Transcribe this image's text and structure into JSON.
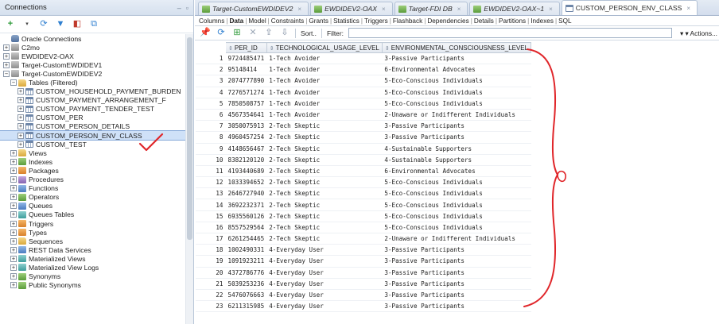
{
  "left_panel": {
    "title": "Connections",
    "root": "Oracle Connections",
    "connections": [
      "C2mo",
      "EWDIDEV2-OAX",
      "Target-CustomEWDIDEV1",
      "Target-CustomEWDIDEV2"
    ],
    "tables_folder": "Tables (Filtered)",
    "tables": [
      "CUSTOM_HOUSEHOLD_PAYMENT_BURDEN",
      "CUSTOM_PAYMENT_ARRANGEMENT_F",
      "CUSTOM_PAYMENT_TENDER_TEST",
      "CUSTOM_PER",
      "CUSTOM_PERSON_DETAILS",
      "CUSTOM_PERSON_ENV_CLASS",
      "CUSTOM_TEST"
    ],
    "folders": [
      "Views",
      "Indexes",
      "Packages",
      "Procedures",
      "Functions",
      "Operators",
      "Queues",
      "Queues Tables",
      "Triggers",
      "Types",
      "Sequences",
      "REST Data Services",
      "Materialized Views",
      "Materialized View Logs",
      "Synonyms",
      "Public Synonyms"
    ]
  },
  "editor_tabs": [
    {
      "label": "Target-CustomEWDIDEV2",
      "active": false
    },
    {
      "label": "EWDIDEV2-OAX",
      "active": false
    },
    {
      "label": "Target-FDI DB",
      "active": false
    },
    {
      "label": "EWDIDEV2-OAX~1",
      "active": false
    },
    {
      "label": "CUSTOM_PERSON_ENV_CLASS",
      "active": true
    }
  ],
  "sub_tabs": [
    "Columns",
    "Data",
    "Model",
    "Constraints",
    "Grants",
    "Statistics",
    "Triggers",
    "Flashback",
    "Dependencies",
    "Details",
    "Partitions",
    "Indexes",
    "SQL"
  ],
  "sub_tab_active": "Data",
  "toolbar": {
    "sort_label": "Sort..",
    "filter_label": "Filter:",
    "actions_label": "Actions..."
  },
  "grid": {
    "columns": [
      "PER_ID",
      "TECHNOLOGICAL_USAGE_LEVEL",
      "ENVIRONMENTAL_CONSCIOUSNESS_LEVEL"
    ],
    "rows": [
      [
        "1",
        "9724485471",
        "1-Tech Avoider",
        "3-Passive Participants"
      ],
      [
        "2",
        "95148414",
        "1-Tech Avoider",
        "6-Environmental Advocates"
      ],
      [
        "3",
        "2074777890",
        "1-Tech Avoider",
        "5-Eco-Conscious Individuals"
      ],
      [
        "4",
        "7276571274",
        "1-Tech Avoider",
        "5-Eco-Conscious Individuals"
      ],
      [
        "5",
        "7850508757",
        "1-Tech Avoider",
        "5-Eco-Conscious Individuals"
      ],
      [
        "6",
        "4567354641",
        "1-Tech Avoider",
        "2-Unaware or Indifferent Individuals"
      ],
      [
        "7",
        "3050075913",
        "2-Tech Skeptic",
        "3-Passive Participants"
      ],
      [
        "8",
        "4960457254",
        "2-Tech Skeptic",
        "3-Passive Participants"
      ],
      [
        "9",
        "4148656467",
        "2-Tech Skeptic",
        "4-Sustainable Supporters"
      ],
      [
        "10",
        "8382120120",
        "2-Tech Skeptic",
        "4-Sustainable Supporters"
      ],
      [
        "11",
        "4193440689",
        "2-Tech Skeptic",
        "6-Environmental Advocates"
      ],
      [
        "12",
        "1033394652",
        "2-Tech Skeptic",
        "5-Eco-Conscious Individuals"
      ],
      [
        "13",
        "2646727940",
        "2-Tech Skeptic",
        "5-Eco-Conscious Individuals"
      ],
      [
        "14",
        "3692232371",
        "2-Tech Skeptic",
        "5-Eco-Conscious Individuals"
      ],
      [
        "15",
        "6935560126",
        "2-Tech Skeptic",
        "5-Eco-Conscious Individuals"
      ],
      [
        "16",
        "8557529564",
        "2-Tech Skeptic",
        "5-Eco-Conscious Individuals"
      ],
      [
        "17",
        "6261254465",
        "2-Tech Skeptic",
        "2-Unaware or Indifferent Individuals"
      ],
      [
        "18",
        "1002490331",
        "4-Everyday User",
        "3-Passive Participants"
      ],
      [
        "19",
        "1091923211",
        "4-Everyday User",
        "3-Passive Participants"
      ],
      [
        "20",
        "4372786776",
        "4-Everyday User",
        "3-Passive Participants"
      ],
      [
        "21",
        "5039253236",
        "4-Everyday User",
        "3-Passive Participants"
      ],
      [
        "22",
        "5476076663",
        "4-Everyday User",
        "3-Passive Participants"
      ],
      [
        "23",
        "6211315985",
        "4-Everyday User",
        "3-Passive Participants"
      ]
    ]
  },
  "colors": {
    "annotation": "#e0262a",
    "selection": "#cfe1f8",
    "header_bg": "#e3e8ef"
  }
}
